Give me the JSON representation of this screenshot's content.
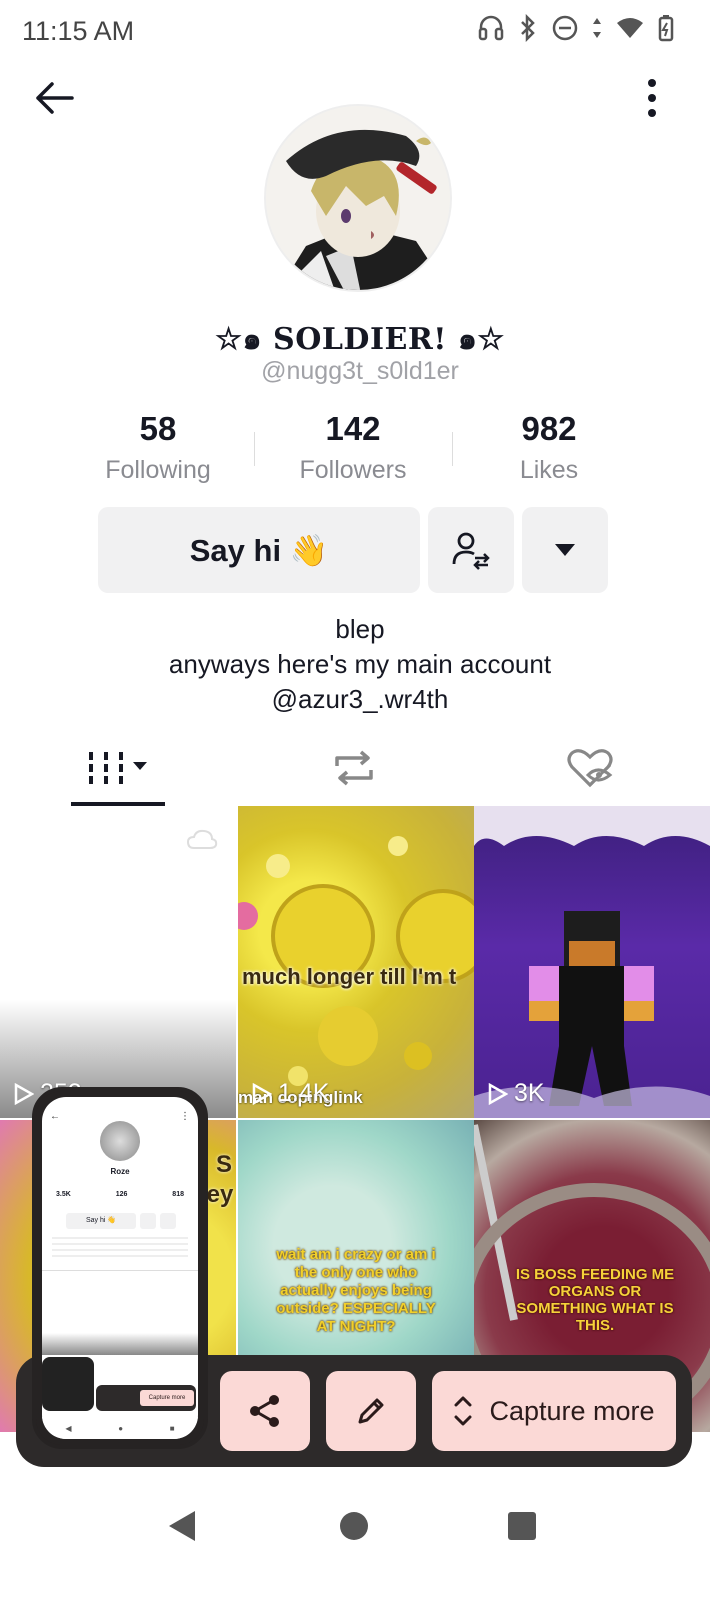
{
  "status": {
    "time": "11:15 AM"
  },
  "profile": {
    "display_name": "☆๑ SOLDIER! ๑☆",
    "username": "@nugg3t_s0ld1er",
    "stats": [
      {
        "value": "58",
        "label": "Following"
      },
      {
        "value": "142",
        "label": "Followers"
      },
      {
        "value": "982",
        "label": "Likes"
      }
    ],
    "say_hi_label": "Say hi 👋",
    "bio": [
      "blep",
      "anyways here's my main account",
      "@azur3_.wr4th"
    ]
  },
  "videos": [
    {
      "views": "252",
      "caption": ""
    },
    {
      "views": "1.4K",
      "caption": "much longer till I'm t",
      "caption2": "man copinglink"
    },
    {
      "views": "3K",
      "caption": ""
    },
    {
      "views": "",
      "caption": "S hey"
    },
    {
      "views": "",
      "caption": "wait am i crazy or am i the only one who actually enjoys being outside? ESPECIALLY AT NIGHT?"
    },
    {
      "views": "",
      "caption": "IS BOSS FEEDING ME ORGANS OR SOMETHING WHAT IS THIS."
    }
  ],
  "capture": {
    "more_label": "Capture more"
  },
  "thumbnail": {
    "name": "Roze",
    "stats": [
      {
        "value": "3.5K",
        "label": "Following"
      },
      {
        "value": "126",
        "label": "Followers"
      },
      {
        "value": "818",
        "label": "Likes"
      }
    ],
    "say_hi": "Say hi 👋",
    "capture_more": "Capture more"
  },
  "colors": {
    "accent_capture": "#fbd9d6",
    "panel": "#2d2a2a",
    "muted": "#8a8b91"
  }
}
